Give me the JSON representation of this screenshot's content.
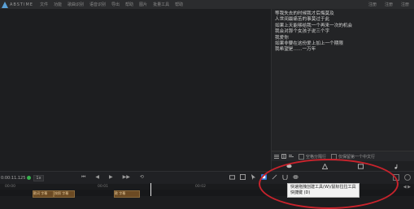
{
  "app": {
    "logo_text": "ABSTIME"
  },
  "menu": [
    "文件",
    "功能",
    "歌曲识别",
    "语音识别",
    "导出",
    "帮助",
    "图片",
    "批量工具",
    "帮助"
  ],
  "window_right": [
    "注册",
    "注册",
    "注册"
  ],
  "lyrics": [
    "等我失去的时候我才后悔莫及",
    "人世间最痛苦的事莫过于此",
    "如果上天能够给我一个再来一次的机会",
    "我会对那个女孩子说三个字",
    "我爱你",
    "如果非要在这份爱上加上一个期限",
    "我希望是……一万年"
  ],
  "panel_toolbar": {
    "checkbox_label": "空格分隔行",
    "checkbox2_label": "仅保留第一个中文行"
  },
  "timeline": {
    "timecode": "0:00:11.125",
    "zoom": "1x"
  },
  "ruler": [
    "00:00",
    "00:01",
    "00:02",
    "00:03"
  ],
  "clips": [
    "歌词 字幕",
    "按照 字幕",
    "歌 字幕"
  ],
  "tooltip": {
    "line1": "快速拖拽创建工具(W)/鼠标拉拉工具",
    "line2": "快捷键 (D)"
  },
  "scroll_ctl": "◀ ▶"
}
